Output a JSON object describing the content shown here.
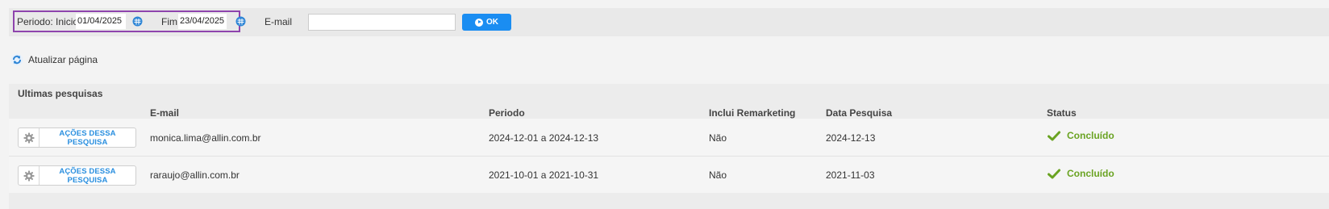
{
  "filter": {
    "period_label": "Periodo: Inicio",
    "start_date": "01/04/2025",
    "end_label": "Fim",
    "end_date": "23/04/2025",
    "email_label": "E-mail",
    "email_value": "",
    "ok_label": "OK"
  },
  "refresh_label": "Atualizar página",
  "panel": {
    "title": "Ultimas pesquisas",
    "columns": [
      "E-mail",
      "Periodo",
      "Inclui Remarketing",
      "Data Pesquisa",
      "Status"
    ],
    "rows": [
      {
        "action_label": "AÇÕES DESSA PESQUISA",
        "email": "monica.lima@allin.com.br",
        "period": "2024-12-01 a 2024-12-13",
        "remarketing": "Não",
        "date": "2024-12-13",
        "status": "Concluído"
      },
      {
        "action_label": "AÇÕES DESSA PESQUISA",
        "email": "raraujo@allin.com.br",
        "period": "2021-10-01 a 2021-10-31",
        "remarketing": "Não",
        "date": "2021-11-03",
        "status": "Concluído"
      }
    ]
  },
  "colors": {
    "highlight_border": "#8e44ad",
    "ok_button": "#1a8df2",
    "status_done": "#6aa322",
    "action_text": "#2a8fdf"
  },
  "icons": {
    "calendar": "calendar-icon",
    "refresh": "refresh-icon",
    "gear": "gear-icon",
    "check": "check-icon",
    "play": "play-icon"
  }
}
